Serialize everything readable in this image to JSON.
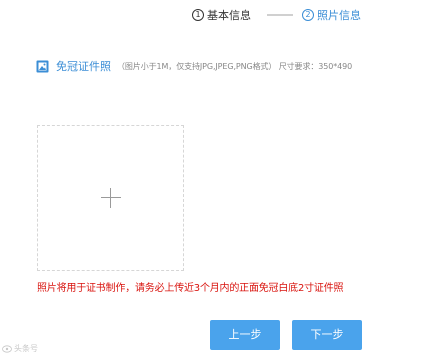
{
  "steps": {
    "step1": {
      "number": "1",
      "label": "基本信息"
    },
    "step2": {
      "number": "2",
      "label": "照片信息"
    }
  },
  "upload": {
    "title": "免冠证件照",
    "hint": "（图片小于1M，仅支持JPG,JPEG,PNG格式）  尺寸要求：350*490"
  },
  "warning": "照片将用于证书制作，请务必上传近3个月内的正面免冠白底2寸证件照",
  "buttons": {
    "prev": "上一步",
    "next": "下一步"
  },
  "watermark": "头条号",
  "colors": {
    "accent": "#3b8ed6",
    "button": "#4aa3ec",
    "warning": "#d9140f"
  }
}
